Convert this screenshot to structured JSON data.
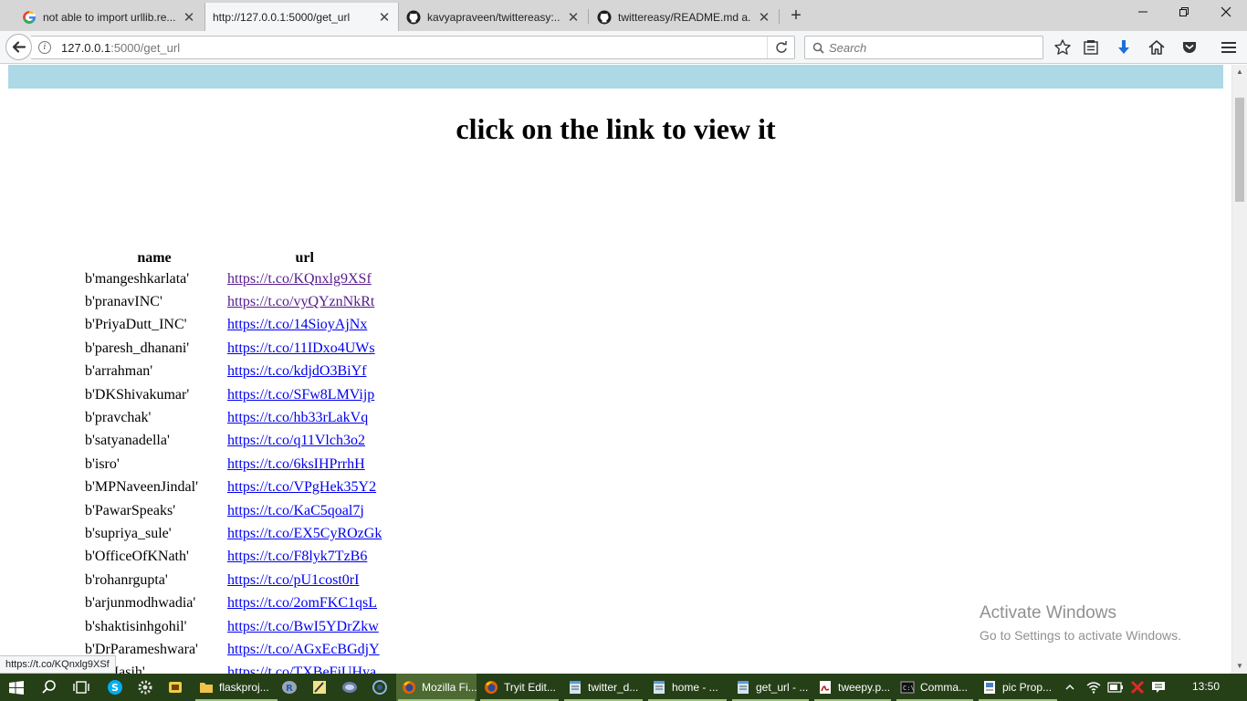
{
  "browser": {
    "tabs": [
      {
        "label": "not able to import urllib.re...",
        "icon": "google-icon",
        "active": false
      },
      {
        "label": "http://127.0.0.1:5000/get_url",
        "icon": "none",
        "active": true
      },
      {
        "label": "kavyapraveen/twittereasy:...",
        "icon": "github-icon",
        "active": false
      },
      {
        "label": "twittereasy/README.md a...",
        "icon": "github-icon",
        "active": false
      }
    ],
    "url_host": "127.0.0.1",
    "url_path": ":5000/get_url",
    "search_placeholder": "Search"
  },
  "page": {
    "heading": "click on the link to view it",
    "columns": [
      "name",
      "url"
    ],
    "rows": [
      {
        "name": "b'mangeshkarlata'",
        "url": "https://t.co/KQnxlg9XSf",
        "visited": true
      },
      {
        "name": "b'pranavINC'",
        "url": "https://t.co/vyQYznNkRt",
        "visited": true
      },
      {
        "name": "b'PriyaDutt_INC'",
        "url": "https://t.co/14SioyAjNx",
        "visited": false
      },
      {
        "name": "b'paresh_dhanani'",
        "url": "https://t.co/11IDxo4UWs",
        "visited": false
      },
      {
        "name": "b'arrahman'",
        "url": "https://t.co/kdjdO3BiYf",
        "visited": false
      },
      {
        "name": "b'DKShivakumar'",
        "url": "https://t.co/SFw8LMVijp",
        "visited": false
      },
      {
        "name": "b'pravchak'",
        "url": "https://t.co/hb33rLakVq",
        "visited": false
      },
      {
        "name": "b'satyanadella'",
        "url": "https://t.co/q11Vlch3o2",
        "visited": false
      },
      {
        "name": "b'isro'",
        "url": "https://t.co/6ksIHPrrhH",
        "visited": false
      },
      {
        "name": "b'MPNaveenJindal'",
        "url": "https://t.co/VPgHek35Y2",
        "visited": false
      },
      {
        "name": "b'PawarSpeaks'",
        "url": "https://t.co/KaC5qoal7j",
        "visited": false
      },
      {
        "name": "b'supriya_sule'",
        "url": "https://t.co/EX5CyROzGk",
        "visited": false
      },
      {
        "name": "b'OfficeOfKNath'",
        "url": "https://t.co/F8lyk7TzB6",
        "visited": false
      },
      {
        "name": "b'rohanrgupta'",
        "url": "https://t.co/pU1cost0rI",
        "visited": false
      },
      {
        "name": "b'arjunmodhwadia'",
        "url": "https://t.co/2omFKC1qsL",
        "visited": false
      },
      {
        "name": "b'shaktisinhgohil'",
        "url": "https://t.co/BwI5YDrZkw",
        "visited": false
      },
      {
        "name": "b'DrParameshwara'",
        "url": "https://t.co/AGxEcBGdjY",
        "visited": false
      },
      {
        "name": "b'...Masih'",
        "url": "https://t.co/TXBeFjUHya",
        "visited": false
      }
    ],
    "status_url": "https://t.co/KQnxlg9XSf"
  },
  "watermark": {
    "title": "Activate Windows",
    "subtitle": "Go to Settings to activate Windows."
  },
  "taskbar": {
    "items": [
      {
        "label": "flaskproj...",
        "icon": "folder-icon",
        "active": false
      },
      {
        "label": "Mozilla Fi...",
        "icon": "firefox-icon",
        "active": true
      },
      {
        "label": "Tryit Edit...",
        "icon": "firefox-icon",
        "active": false
      },
      {
        "label": "twitter_d...",
        "icon": "notepad-icon",
        "active": false
      },
      {
        "label": "home - ...",
        "icon": "notepad-icon",
        "active": false
      },
      {
        "label": "get_url - ...",
        "icon": "notepad-icon",
        "active": false
      },
      {
        "label": "tweepy.p...",
        "icon": "pdf-icon",
        "active": false
      },
      {
        "label": "Comma...",
        "icon": "cmd-icon",
        "active": false
      },
      {
        "label": "pic Prop...",
        "icon": "document-icon",
        "active": false
      }
    ],
    "clock": "13:50",
    "colors": {
      "bar": "#253f17",
      "active_item": "#4e6a33"
    }
  },
  "colors": {
    "banner": "#add8e6",
    "link": "#0000ee",
    "visited_link": "#551a8b"
  }
}
